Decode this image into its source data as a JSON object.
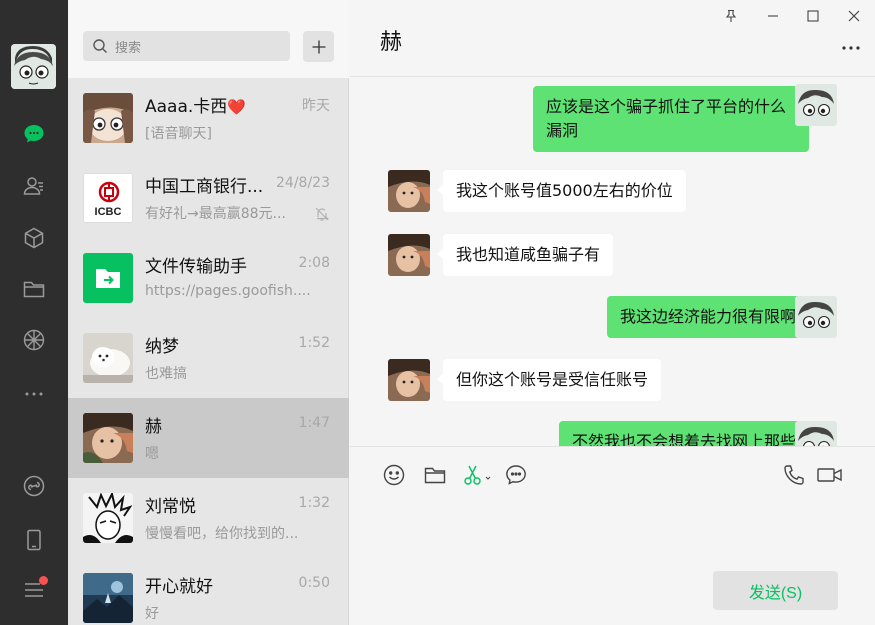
{
  "search": {
    "placeholder": "搜索"
  },
  "conversations": [
    {
      "name": "Aaaa.卡西",
      "heart": "❤️",
      "time": "昨天",
      "preview": "[语音聊天]"
    },
    {
      "name": "中国工商银行...",
      "time": "24/8/23",
      "preview": "有好礼→最高赢88元...",
      "muted": true,
      "logo_text": "ICBC"
    },
    {
      "name": "文件传输助手",
      "time": "2:08",
      "preview": "https://pages.goofish...."
    },
    {
      "name": "纳梦",
      "time": "1:52",
      "preview": "也难搞"
    },
    {
      "name": "赫",
      "time": "1:47",
      "preview": "嗯",
      "selected": true
    },
    {
      "name": "刘常悦",
      "time": "1:32",
      "preview": "慢慢看吧，给你找到的..."
    },
    {
      "name": "开心就好",
      "time": "0:50",
      "preview": "好"
    }
  ],
  "chat": {
    "title": "赫",
    "messages": [
      {
        "from": "me",
        "text": "应该是这个骗子抓住了平台的什么漏洞"
      },
      {
        "from": "them",
        "text": "我这个账号值5000左右的价位"
      },
      {
        "from": "them",
        "text": "我也知道咸鱼骗子有"
      },
      {
        "from": "me",
        "text": "我这边经济能力很有限啊"
      },
      {
        "from": "them",
        "text": "但你这个账号是受信任账号"
      },
      {
        "from": "me",
        "text": "不然我也不会想着去找网上那些"
      }
    ],
    "send_label": "发送(S)"
  },
  "icons": {
    "rail": [
      "chat-icon",
      "contacts-icon",
      "favorites-icon",
      "files-icon",
      "moments-icon",
      "more-icon",
      "mini-program-icon",
      "phone-icon",
      "menu-icon"
    ],
    "toolbar": [
      "emoji-icon",
      "folder-icon",
      "scissors-icon",
      "chat-history-icon",
      "voice-call-icon",
      "video-call-icon"
    ]
  },
  "colors": {
    "accent": "#07c160",
    "my_bubble": "#5ee273",
    "rail_bg": "#2e2e2e"
  }
}
